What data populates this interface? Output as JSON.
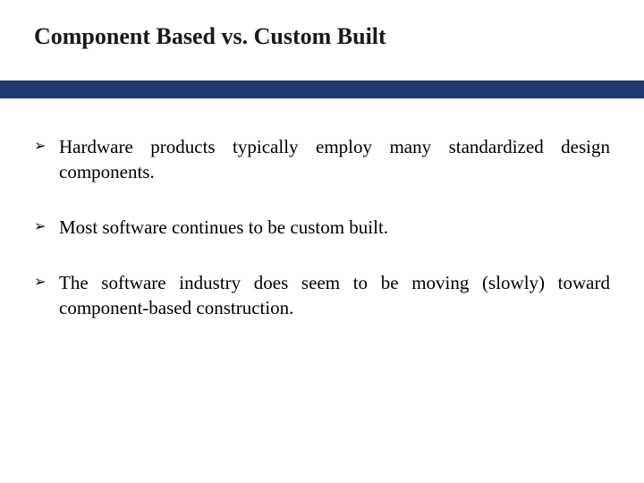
{
  "title": "Component Based vs. Custom Built",
  "bullets": [
    {
      "marker": "➢",
      "text": "Hardware products typically employ many standardized design components.",
      "justify": true
    },
    {
      "marker": "➢",
      "text": "Most software continues to be custom built.",
      "justify": false
    },
    {
      "marker": "➢",
      "text": "The software industry does seem to be moving (slowly) toward component-based construction.",
      "justify": true
    }
  ],
  "colors": {
    "divider": "#1f3a6e"
  }
}
